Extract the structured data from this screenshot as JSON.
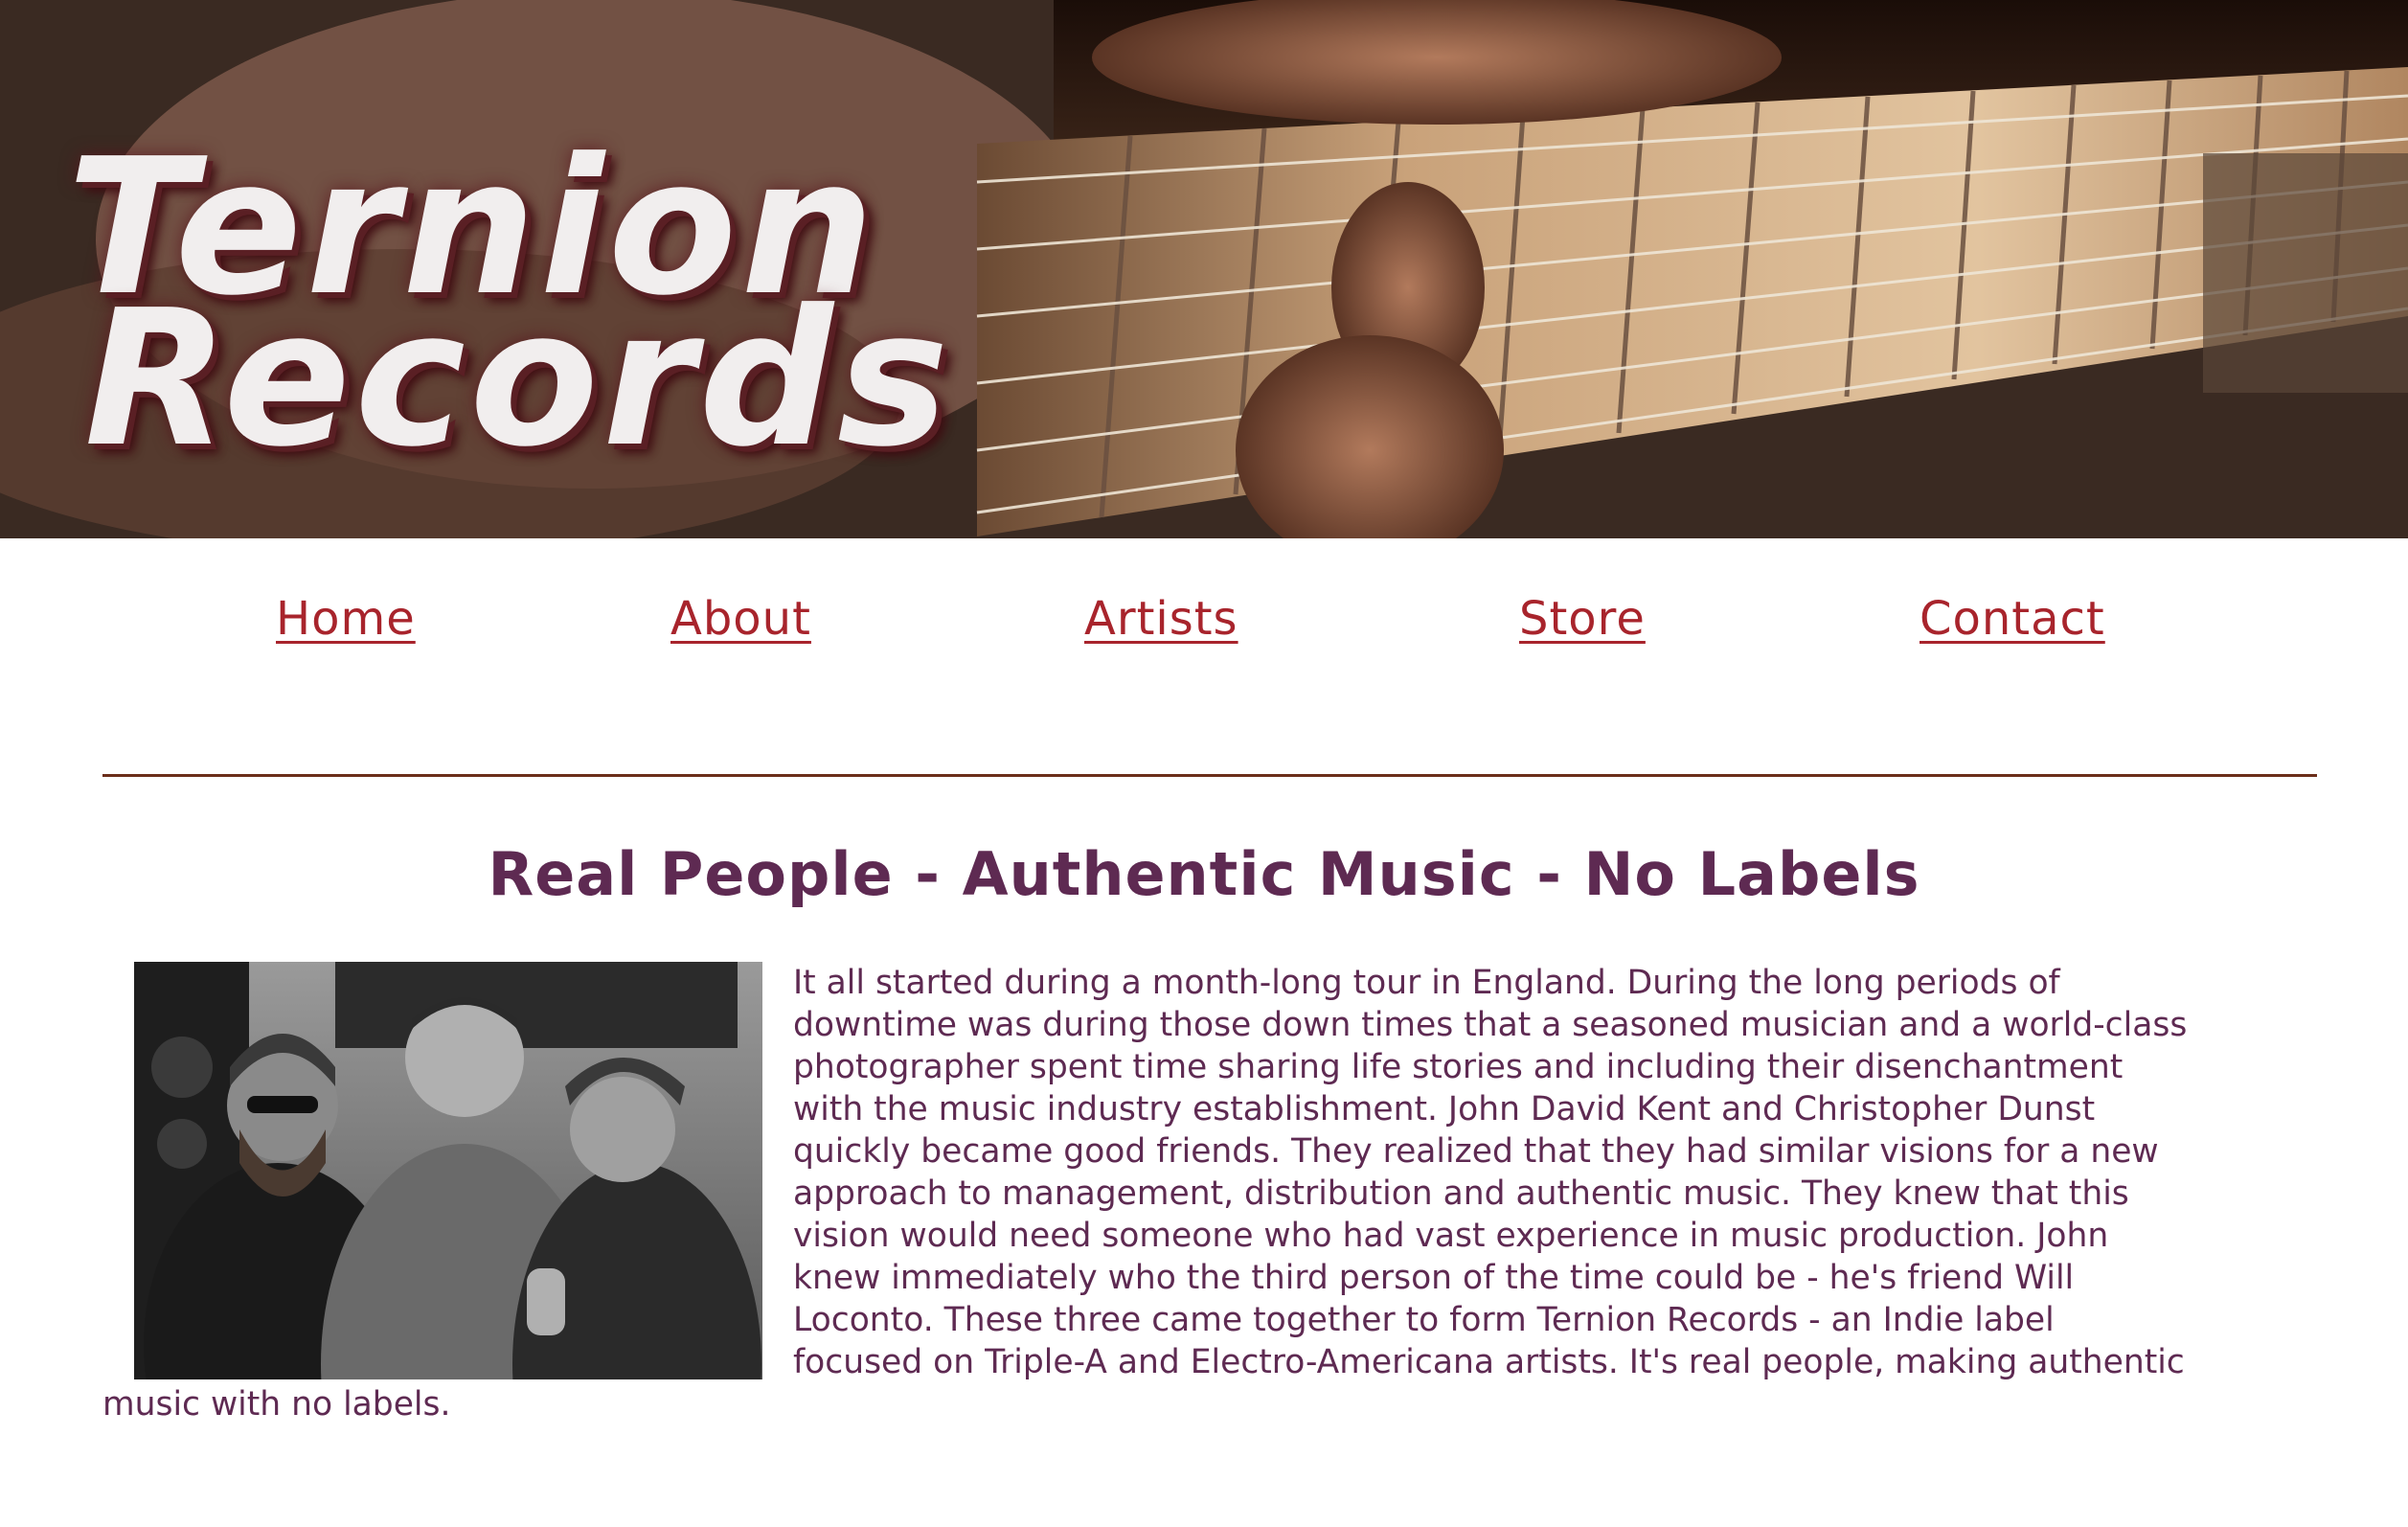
{
  "banner": {
    "logo_line1": "Ternion",
    "logo_line2": "Records",
    "image_subject": "guitar-fretboard-photo"
  },
  "nav": {
    "items": [
      {
        "label": "Home"
      },
      {
        "label": "About"
      },
      {
        "label": "Artists"
      },
      {
        "label": "Store"
      },
      {
        "label": "Contact"
      }
    ]
  },
  "main": {
    "headline": "Real People - Authentic Music - No Labels",
    "photo_subject": "three-band-members-black-and-white-photo",
    "body": "It all started during a month-long tour in England. During the long periods of downtime was during those down times that a seasoned musician and a world-class photographer spent time sharing life stories and including their disenchantment with the music industry establishment. John David Kent and Christopher Dunst quickly became good friends. They realized that they had similar visions for a new approach to management, distribution and authentic music. They knew that this vision would need someone who had vast experience in music production. John knew immediately who the third person of the time could be - he's friend Will Loconto. These three came together to form Ternion Records - an Indie label focused on Triple-A and Electro-Americana artists. It's real people, making authentic music with no labels."
  },
  "colors": {
    "link": "#a8242c",
    "text": "#5e2a52",
    "divider": "#6b2e1a",
    "logo_fill": "#f1eeee",
    "logo_shadow": "#5a1f24"
  }
}
